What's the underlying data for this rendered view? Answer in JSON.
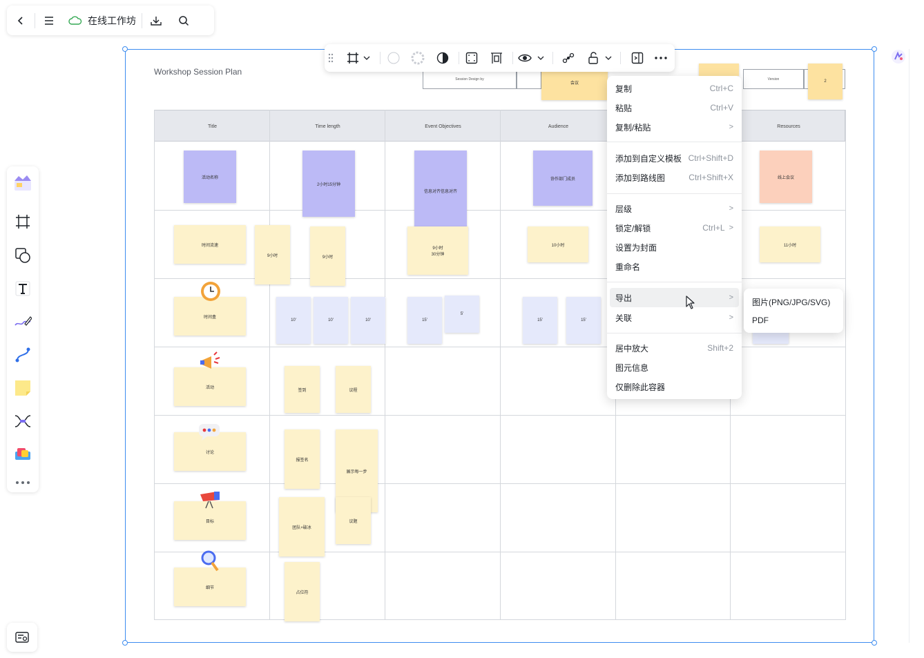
{
  "topbar": {
    "back_icon": "chevron-left-icon",
    "menu_icon": "hamburger-icon",
    "cloud_icon": "cloud-saved-icon",
    "title": "在线工作坊",
    "download_icon": "download-icon",
    "search_icon": "search-icon"
  },
  "palette": {
    "items": [
      "template-icon",
      "frame-icon",
      "shape-icon",
      "text-icon",
      "pen-icon",
      "connector-icon",
      "sticky-note-icon",
      "mindmap-icon",
      "sticker-icon",
      "more-icon"
    ]
  },
  "board": {
    "title": "Workshop Session Plan",
    "top_boxes": [
      "Session Design by",
      "",
      "Version",
      "2"
    ],
    "gold_note": "会议",
    "columns": [
      "Title",
      "Time length",
      "Event Objectives",
      "Audience",
      "",
      "Resources"
    ],
    "row1": {
      "title": "活动名称",
      "time": "2小时15分钟",
      "objective": "信息对齐信息对齐",
      "audience": "协作部门成员",
      "resource": "线上会议"
    },
    "row2": {
      "title": "时间流速",
      "time_a": "9小时",
      "time_b": "9小时",
      "objective": "9小时\n30分钟",
      "audience": "10小时",
      "resource": "11小时"
    },
    "row3": {
      "title": "时间盒",
      "times": [
        "10'",
        "10'",
        "10'"
      ],
      "objectives": [
        "15'",
        "5'"
      ],
      "audience": [
        "15'",
        "15'"
      ]
    },
    "row4": {
      "title": "活动",
      "notes": [
        "签到",
        "议程"
      ]
    },
    "row5": {
      "title": "讨论",
      "notes": [
        "报签名",
        "展示每一步"
      ]
    },
    "row6": {
      "title": "目标",
      "notes": [
        "团队+破冰",
        "议题"
      ]
    },
    "row7": {
      "title": "细节",
      "notes": [
        "占位符"
      ]
    }
  },
  "context_menu": {
    "items": [
      {
        "label": "复制",
        "shortcut": "Ctrl+C"
      },
      {
        "label": "粘贴",
        "shortcut": "Ctrl+V"
      },
      {
        "label": "复制/粘贴",
        "arrow": ">"
      },
      {
        "label": "添加到自定义模板",
        "shortcut": "Ctrl+Shift+D"
      },
      {
        "label": "添加到路线图",
        "shortcut": "Ctrl+Shift+X"
      },
      {
        "label": "层级",
        "arrow": ">"
      },
      {
        "label": "锁定/解锁",
        "shortcut": "Ctrl+L",
        "arrow": ">"
      },
      {
        "label": "设置为封面"
      },
      {
        "label": "重命名"
      },
      {
        "label": "导出",
        "arrow": ">"
      },
      {
        "label": "关联",
        "arrow": ">"
      },
      {
        "label": "居中放大",
        "shortcut": "Shift+2"
      },
      {
        "label": "图元信息"
      },
      {
        "label": "仅删除此容器"
      }
    ]
  },
  "export_submenu": {
    "items": [
      "图片(PNG/JPG/SVG)",
      "PDF"
    ]
  },
  "colors": {
    "selection": "#3c8cf0",
    "note_yellow": "#fdf2cb",
    "note_purple": "#bcbaf6",
    "note_peach": "#fcd0bc",
    "note_lightblue": "#e5e9fb"
  }
}
